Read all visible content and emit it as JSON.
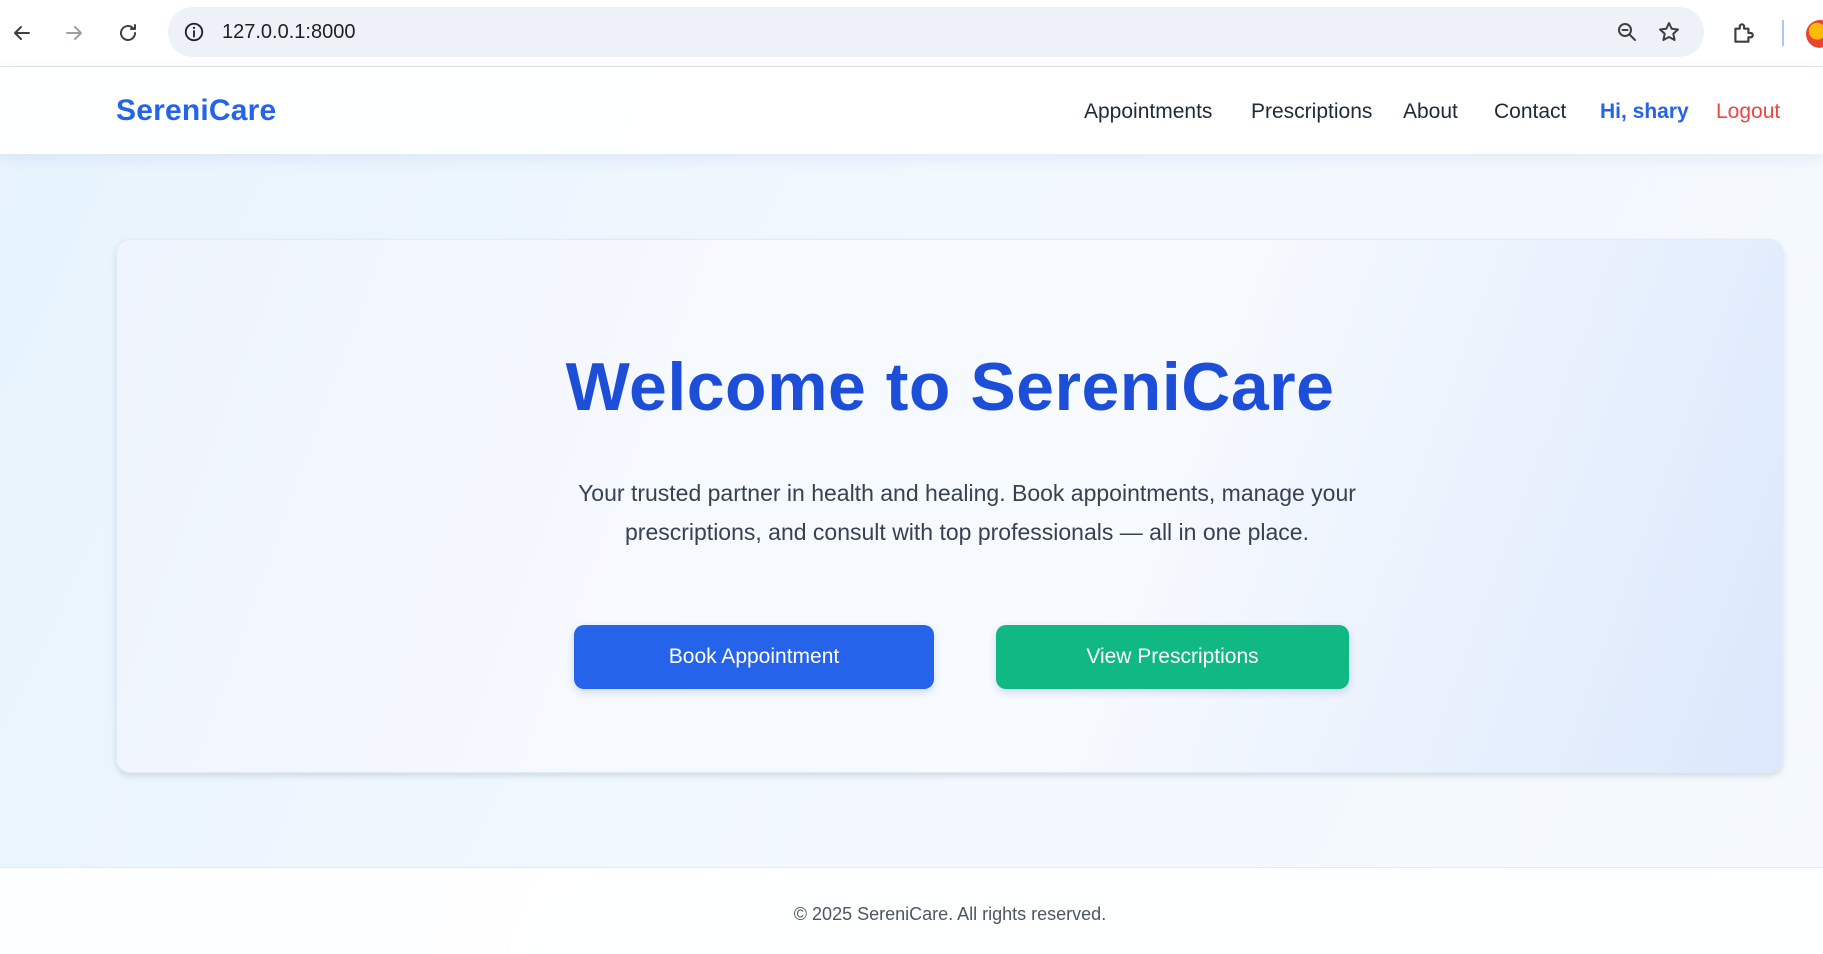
{
  "browser": {
    "url": "127.0.0.1:8000",
    "icons": [
      "back-arrow-icon",
      "forward-arrow-icon",
      "reload-icon",
      "info-icon",
      "zoom-icon",
      "star-icon",
      "extensions-icon"
    ]
  },
  "header": {
    "brand": "SereniCare",
    "nav": {
      "appointments": "Appointments",
      "prescriptions": "Prescriptions",
      "about": "About",
      "contact": "Contact",
      "user_greeting": "Hi, shary",
      "logout": "Logout"
    }
  },
  "hero": {
    "title": "Welcome to SereniCare",
    "subtitle_line1": "Your trusted partner in health and healing. Book appointments, manage your",
    "subtitle_line2": "prescriptions, and consult with top professionals — all in one place.",
    "book_button": "Book Appointment",
    "view_button": "View Prescriptions"
  },
  "footer": {
    "text": "© 2025 SereniCare. All rights reserved."
  },
  "colors": {
    "brand_blue": "#2563eb",
    "title_blue": "#1d4ed8",
    "green": "#10b981",
    "logout_red": "#ef4444"
  }
}
